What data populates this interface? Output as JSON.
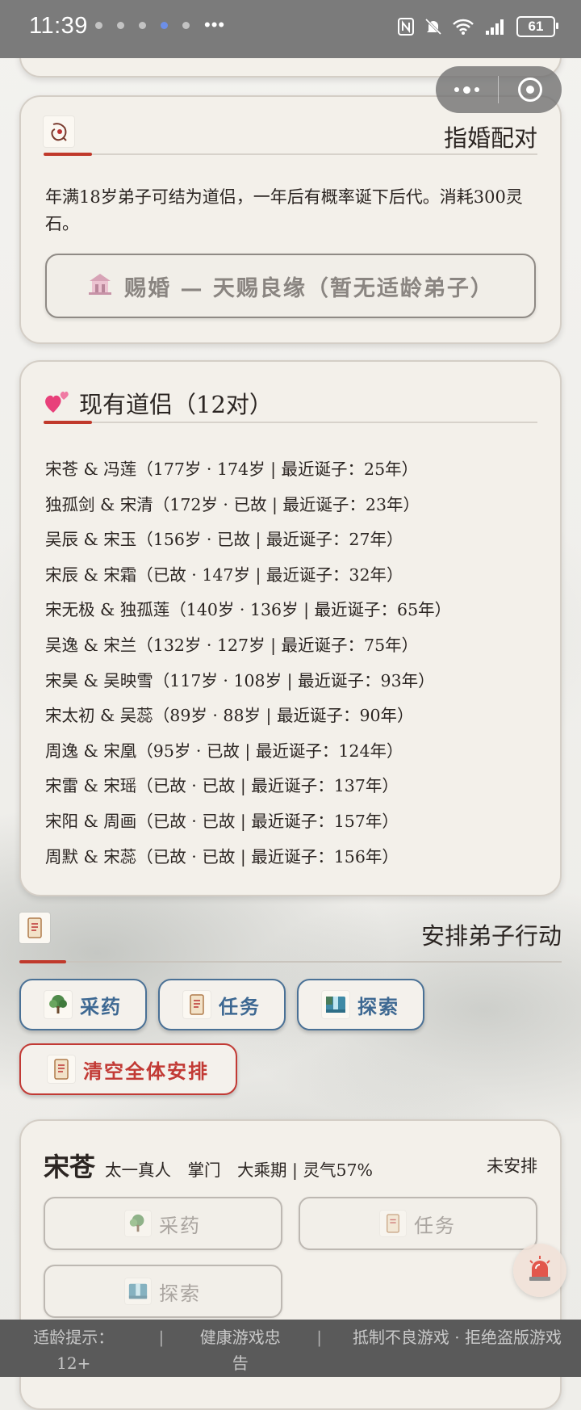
{
  "status_bar": {
    "time": "11:39",
    "battery": "61"
  },
  "marriage": {
    "title": "指婚配对",
    "description": "年满18岁弟子可结为道侣，一年后有概率诞下后代。消耗300灵石。",
    "button_label": "赐婚 — 天赐良缘（暂无适龄弟子）"
  },
  "couples": {
    "title": "现有道侣（12对）",
    "items": [
      "宋苍 & 冯莲（177岁 · 174岁 | 最近诞子：25年）",
      "独孤剑 & 宋清（172岁 · 已故 | 最近诞子：23年）",
      "吴辰 & 宋玉（156岁 · 已故 | 最近诞子：27年）",
      "宋辰 & 宋霜（已故 · 147岁 | 最近诞子：32年）",
      "宋无极 & 独孤莲（140岁 · 136岁 | 最近诞子：65年）",
      "吴逸 & 宋兰（132岁 · 127岁 | 最近诞子：75年）",
      "宋昊 & 吴映雪（117岁 · 108岁 | 最近诞子：93年）",
      "宋太初 & 吴蕊（89岁 · 88岁 | 最近诞子：90年）",
      "周逸 & 宋凰（95岁 · 已故 | 最近诞子：124年）",
      "宋雷 & 宋瑶（已故 · 已故 | 最近诞子：137年）",
      "宋阳 & 周画（已故 · 已故 | 最近诞子：157年）",
      "周默 & 宋蕊（已故 · 已故 | 最近诞子：156年）"
    ]
  },
  "arrange": {
    "title": "安排弟子行动",
    "buttons": {
      "herb": "采药",
      "task": "任务",
      "explore": "探索",
      "clear": "清空全体安排"
    }
  },
  "disciple": {
    "name": "宋苍",
    "info": "太一真人　掌门　大乘期 | 灵气57%",
    "status": "未安排",
    "buttons": {
      "herb": "采药",
      "task": "任务",
      "explore": "探索"
    }
  },
  "footer": {
    "age": "适龄提示：12+",
    "sep": "|",
    "health": "健康游戏忠告",
    "anti": "抵制不良游戏 · 拒绝盗版游戏"
  },
  "colors": {
    "accent_red": "#c0392b",
    "button_blue": "#3d6892",
    "clear_red": "#c23a35"
  },
  "icons": [
    "scroll-icon",
    "hearts-icon",
    "temple-icon",
    "herb-tree-icon",
    "task-scroll-icon",
    "waterfall-icon",
    "alarm-icon"
  ]
}
